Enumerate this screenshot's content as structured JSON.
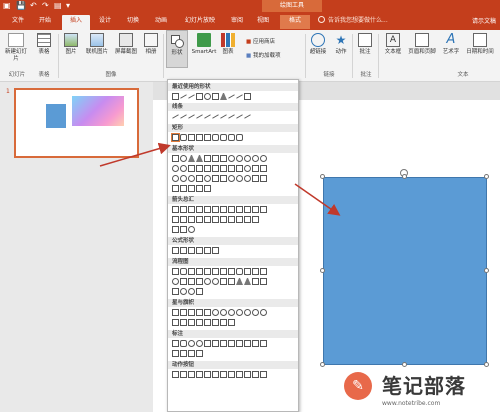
{
  "title_bar": {
    "context_group": "绘图工具",
    "quick_access": [
      "↶",
      "↷",
      "▣",
      "▾"
    ]
  },
  "tabs": [
    {
      "label": "文件"
    },
    {
      "label": "开始"
    },
    {
      "label": "插入"
    },
    {
      "label": "设计"
    },
    {
      "label": "切换"
    },
    {
      "label": "动画"
    },
    {
      "label": "幻灯片放映"
    },
    {
      "label": "审阅"
    },
    {
      "label": "视图"
    },
    {
      "label": "格式"
    }
  ],
  "tell_me": "告诉我您想要做什么...",
  "account": "请示文稿",
  "ribbon": {
    "new_slide": "新建幻灯片",
    "table": "表格",
    "picture": "图片",
    "online_picture": "联机图片",
    "screenshot": "屏幕截图",
    "album": "相册",
    "shapes": "形状",
    "smartart": "SmartArt",
    "chart": "图表",
    "store": "应用商店",
    "my_addins": "我的加载项",
    "hyperlink": "超链接",
    "action": "动作",
    "comment": "批注",
    "textbox": "文本框",
    "header_footer": "页眉和页脚",
    "wordart": "艺术字",
    "datetime": "日期和时间",
    "groups": {
      "slides": "幻灯片",
      "tables": "表格",
      "images": "图像",
      "links": "链接",
      "comments": "批注",
      "text": "文本"
    }
  },
  "slide_panel": {
    "number": "1"
  },
  "shapes_menu": {
    "sections": [
      "最近使用的形状",
      "线条",
      "矩形",
      "基本形状",
      "箭头总汇",
      "公式形状",
      "流程图",
      "星与旗帜",
      "标注",
      "动作按钮"
    ]
  },
  "watermark": {
    "brand": "笔记部落",
    "url": "www.notetribe.com"
  },
  "colors": {
    "accent": "#c43e1c",
    "shape_fill": "#5b9bd5",
    "arrow": "#c0392b"
  }
}
